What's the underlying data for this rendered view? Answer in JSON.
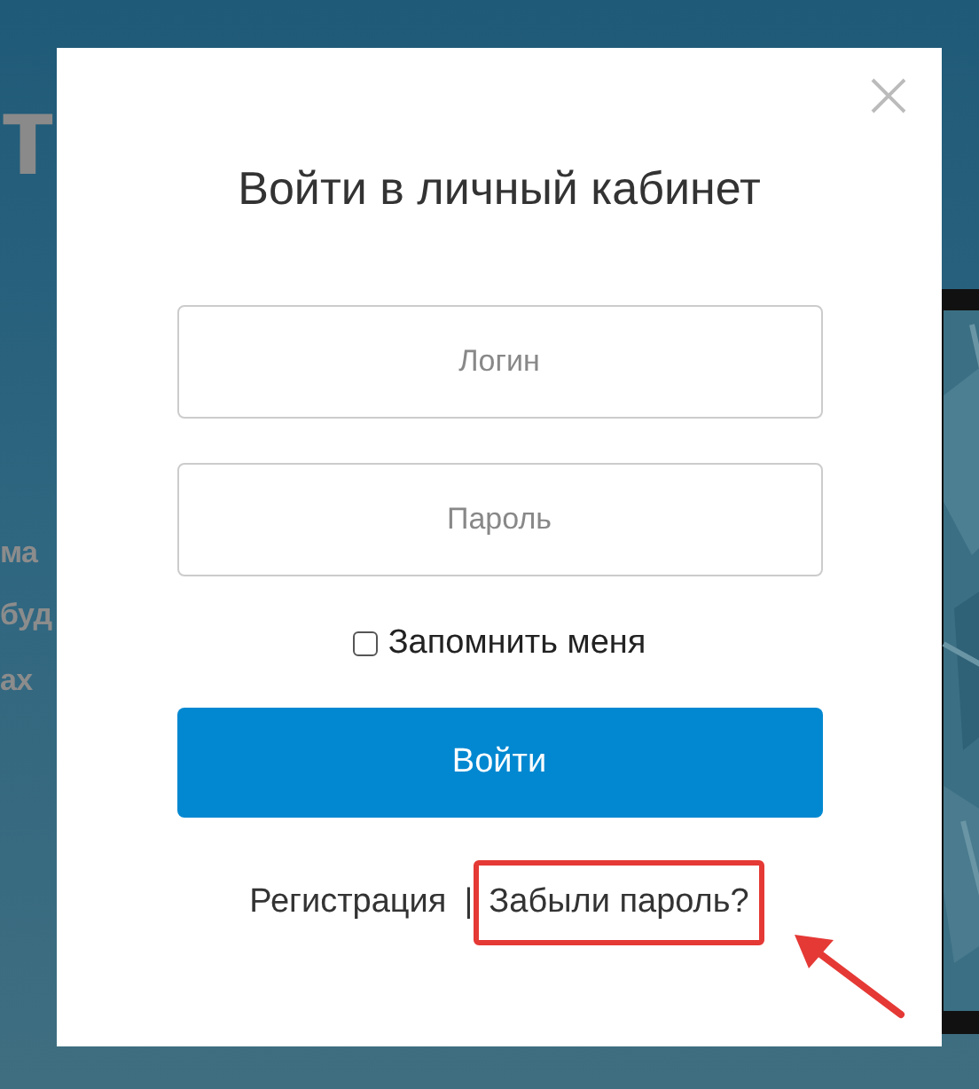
{
  "background_page": {
    "heading_fragment": "т",
    "text_fragments": [
      "ма",
      "буд",
      "ах"
    ]
  },
  "dialog": {
    "title": "Войти в личный кабинет",
    "fields": [
      {
        "placeholder": "Логин"
      },
      {
        "placeholder": "Пароль"
      }
    ],
    "remember": {
      "label": "Запомнить меня",
      "checked": false
    },
    "submit": "Войти",
    "links": [
      {
        "label": "Регистрация",
        "highlighted": false
      },
      {
        "label": "Забыли пароль?",
        "highlighted": true
      }
    ],
    "separator": "|"
  }
}
